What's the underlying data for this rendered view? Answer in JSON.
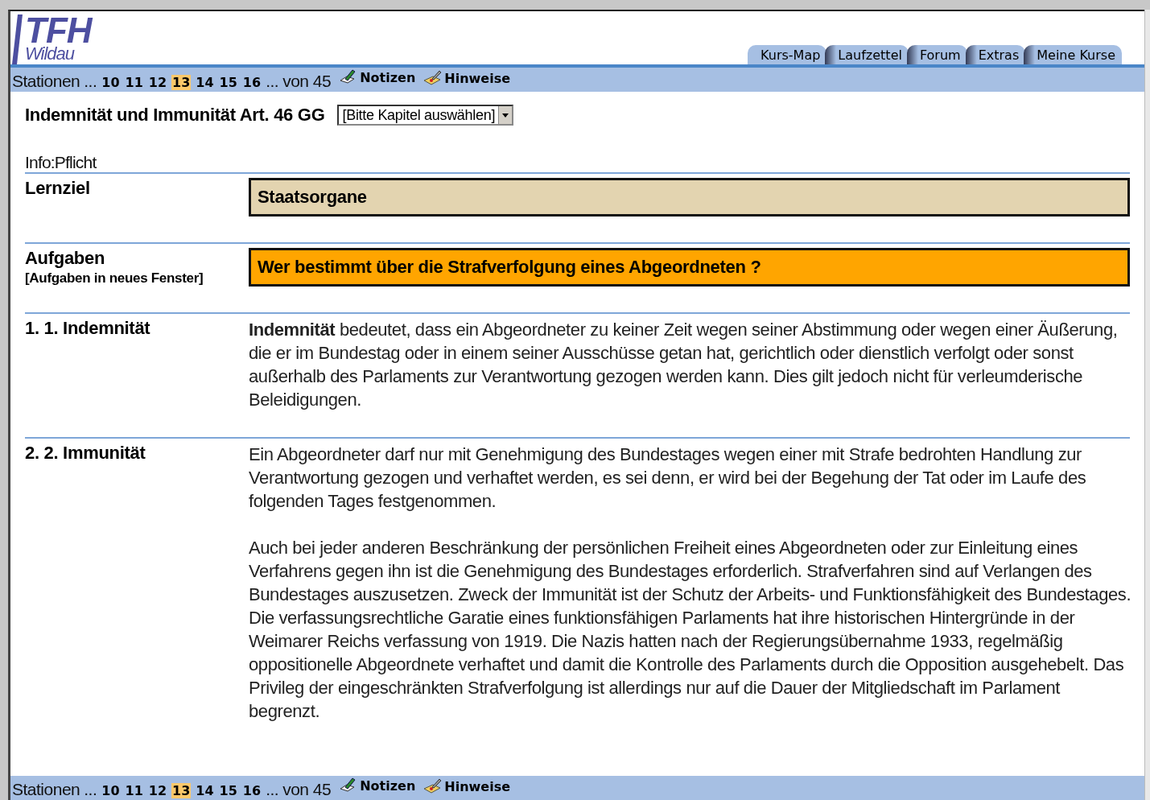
{
  "logo": {
    "title": "TFH",
    "subtitle": "Wildau"
  },
  "tabs": [
    {
      "label": "Kurs-Map"
    },
    {
      "label": "Laufzettel"
    },
    {
      "label": "Forum"
    },
    {
      "label": "Extras"
    },
    {
      "label": "Meine Kurse"
    }
  ],
  "station_bars": [
    {
      "label": "Stationen",
      "ellipsis_before": "...",
      "stations": [
        {
          "label": "10",
          "selected": false
        },
        {
          "label": "11",
          "selected": false
        },
        {
          "label": "12",
          "selected": false
        },
        {
          "label": "13",
          "selected": true
        },
        {
          "label": "14",
          "selected": false
        },
        {
          "label": "15",
          "selected": false
        },
        {
          "label": "16",
          "selected": false
        }
      ],
      "ellipsis_after": "...",
      "total": "von 45",
      "links": [
        {
          "label": "Notizen",
          "kind": "notes"
        },
        {
          "label": "Hinweise",
          "kind": "hints"
        }
      ]
    },
    {
      "label": "Stationen",
      "ellipsis_before": "...",
      "stations": [
        {
          "label": "10",
          "selected": false
        },
        {
          "label": "11",
          "selected": false
        },
        {
          "label": "12",
          "selected": false
        },
        {
          "label": "13",
          "selected": true
        },
        {
          "label": "14",
          "selected": false
        },
        {
          "label": "15",
          "selected": false
        },
        {
          "label": "16",
          "selected": false
        }
      ],
      "ellipsis_after": "...",
      "total": "von 45",
      "links": [
        {
          "label": "Notizen",
          "kind": "notes"
        },
        {
          "label": "Hinweise",
          "kind": "hints"
        }
      ]
    }
  ],
  "page_title": "Indemnität und Immunität Art. 46 GG",
  "chapter_select": {
    "value": "[Bitte Kapitel auswählen]"
  },
  "info": "Info:Pflicht",
  "rows": [
    {
      "kind": "box",
      "label": "Lernziel",
      "color": "#e3d4b0",
      "text": "Staatsorgane"
    },
    {
      "kind": "box",
      "label": "Aufgaben",
      "sublabel": "[Aufgaben in neues Fenster]",
      "color": "#ffa500",
      "text": "Wer bestimmt über die Strafverfolgung eines Abgeordneten ?"
    },
    {
      "kind": "text",
      "label": "1. 1. Indemnität",
      "paragraphs": [
        "**Indemnität** bedeutet, dass ein Abgeordneter zu keiner Zeit wegen seiner Abstimmung oder wegen einer Äußerung, die er im Bundestag oder in einem seiner Ausschüsse getan hat, gerichtlich oder dienstlich verfolgt oder sonst außerhalb des Parlaments zur Verantwortung gezogen werden kann. Dies gilt jedoch nicht für verleumderische Beleidigungen."
      ]
    },
    {
      "kind": "text",
      "label": "2. 2. Immunität",
      "paragraphs": [
        "Ein Abgeordneter darf nur mit Genehmigung des Bundestages wegen einer mit Strafe bedrohten Handlung zur Verantwortung gezogen und verhaftet werden, es sei denn, er wird bei der Begehung der Tat oder im Laufe des folgenden Tages festgenommen.",
        "Auch bei jeder anderen Beschränkung der persönlichen Freiheit eines Abgeordneten oder zur Einleitung eines Verfahrens gegen ihn ist die Genehmigung des Bundestages erforderlich. Strafverfahren sind auf Verlangen des Bundestages auszusetzen. Zweck der Immunität ist der Schutz der Arbeits- und Funktionsfähigkeit des Bundestages. Die verfassungsrechtliche Garatie eines funktionsfähigen Parlaments hat ihre historischen Hintergründe in der Weimarer Reichs verfassung von 1919. Die Nazis hatten nach der Regierungsübernahme 1933, regelmäßig oppositionelle Abgeordnete verhaftet und damit die Kontrolle des Parlaments durch die Opposition ausgehebelt. Das Privileg der eingeschränkten Strafverfolgung ist allerdings nur auf die Dauer der Mitgliedschaft im Parlament begrenzt."
      ]
    }
  ]
}
